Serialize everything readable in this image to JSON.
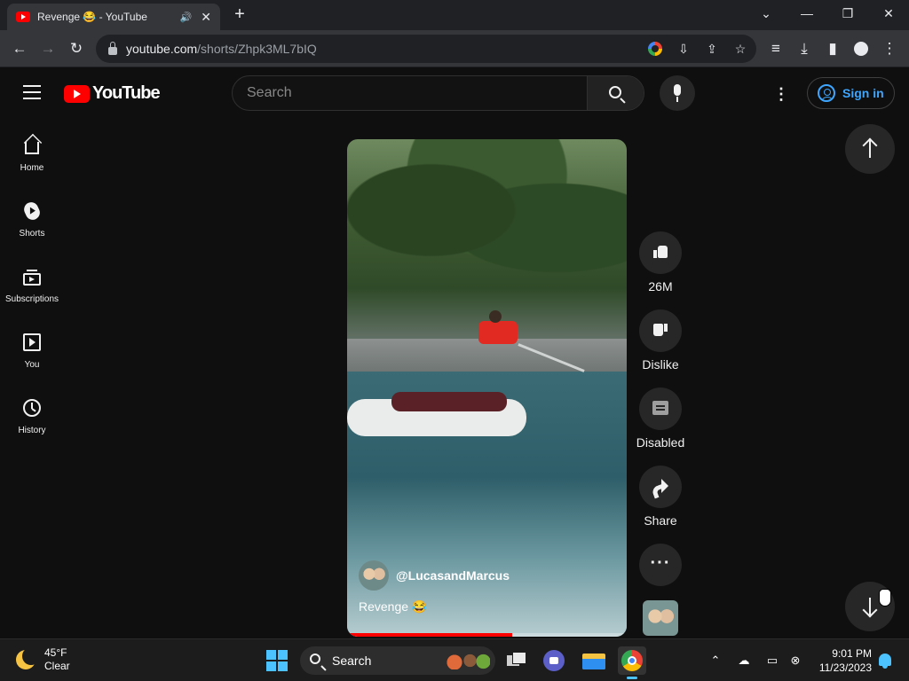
{
  "browser": {
    "tab_title": "Revenge 😂 - YouTube",
    "url_host": "youtube.com",
    "url_path": "/shorts/Zhpk3ML7bIQ",
    "icons": [
      "back-icon",
      "forward-icon",
      "reload-icon",
      "lock-icon",
      "google-icon",
      "install-icon",
      "share-icon",
      "bookmark-star-icon",
      "media-queue-icon",
      "download-icon",
      "side-panel-icon",
      "profile-icon",
      "more-icon"
    ]
  },
  "header": {
    "logo_text": "YouTube",
    "search_placeholder": "Search",
    "signin_label": "Sign in"
  },
  "sidebar": {
    "items": [
      {
        "label": "Home",
        "icon": "home-icon"
      },
      {
        "label": "Shorts",
        "icon": "shorts-icon"
      },
      {
        "label": "Subscriptions",
        "icon": "subscriptions-icon"
      },
      {
        "label": "You",
        "icon": "you-icon"
      },
      {
        "label": "History",
        "icon": "history-icon"
      }
    ]
  },
  "short": {
    "channel": "@LucasandMarcus",
    "title": "Revenge 😂",
    "progress_fraction": 0.59
  },
  "actions": {
    "likes": "26M",
    "dislike": "Dislike",
    "comments": "Disabled",
    "share": "Share"
  },
  "taskbar": {
    "temp": "45°F",
    "condition": "Clear",
    "search_label": "Search",
    "time": "9:01 PM",
    "date": "11/23/2023"
  },
  "colors": {
    "accent_red": "#ff0000",
    "link_blue": "#3ea6ff",
    "background": "#0f0f0f"
  }
}
